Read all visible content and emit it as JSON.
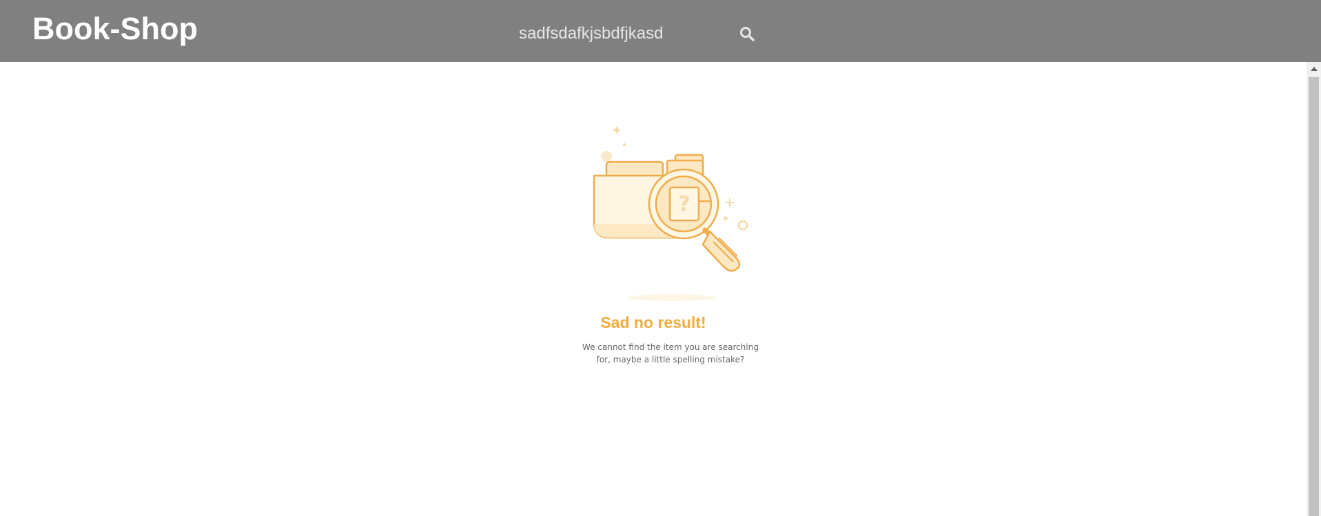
{
  "header": {
    "brand": "Book-Shop",
    "search": {
      "value": "sadfsdafkjsbdfjkasd",
      "placeholder": ""
    },
    "search_icon": "search-icon"
  },
  "empty_state": {
    "illustration": "folder-magnifier-illustration",
    "title": "Sad no result!",
    "message": "We cannot find the item you are searching for, maybe a little spelling mistake?"
  },
  "colors": {
    "header_bg": "#808080",
    "accent": "#f0ad3e"
  }
}
